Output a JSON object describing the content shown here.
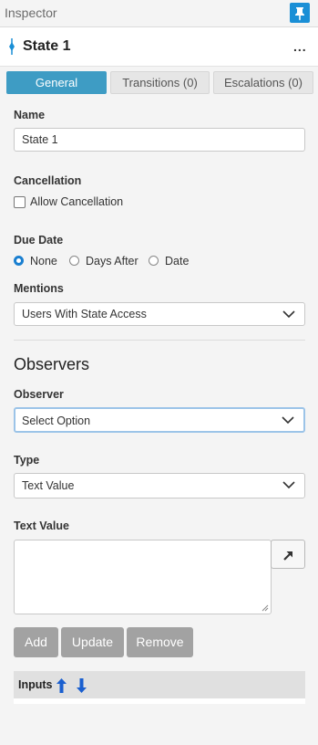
{
  "panel": {
    "title": "Inspector",
    "pin_icon": "pin-icon"
  },
  "header": {
    "state_title": "State 1",
    "more_label": "..."
  },
  "tabs": [
    {
      "label": "General",
      "active": true
    },
    {
      "label": "Transitions (0)",
      "active": false
    },
    {
      "label": "Escalations (0)",
      "active": false
    }
  ],
  "general": {
    "name_label": "Name",
    "name_value": "State 1",
    "cancellation_label": "Cancellation",
    "allow_cancellation_label": "Allow Cancellation",
    "allow_cancellation_checked": false,
    "due_date_label": "Due Date",
    "due_date_options": [
      {
        "label": "None",
        "selected": true
      },
      {
        "label": "Days After",
        "selected": false
      },
      {
        "label": "Date",
        "selected": false
      }
    ],
    "mentions_label": "Mentions",
    "mentions_value": "Users With State Access"
  },
  "observers": {
    "section_title": "Observers",
    "observer_label": "Observer",
    "observer_value": "Select Option",
    "type_label": "Type",
    "type_value": "Text Value",
    "text_value_label": "Text Value",
    "text_value": "",
    "buttons": {
      "add": "Add",
      "update": "Update",
      "remove": "Remove"
    },
    "inputs_label": "Inputs"
  },
  "colors": {
    "accent": "#3e9cc4",
    "pin": "#1a8fd6",
    "disabled_button": "#a2a2a2",
    "arrow": "#1a5fcf"
  }
}
